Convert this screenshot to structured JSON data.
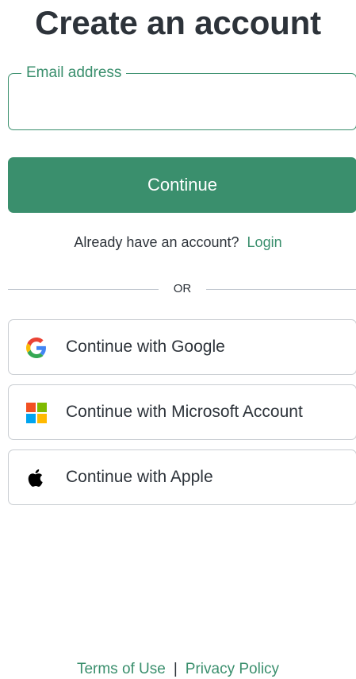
{
  "header": {
    "title": "Create an account"
  },
  "form": {
    "email_label": "Email address",
    "email_value": "",
    "continue_label": "Continue"
  },
  "login_prompt": {
    "text": "Already have an account?",
    "link_label": "Login"
  },
  "divider": {
    "label": "OR"
  },
  "social": [
    {
      "label": "Continue with Google",
      "icon": "google-icon"
    },
    {
      "label": "Continue with Microsoft Account",
      "icon": "microsoft-icon"
    },
    {
      "label": "Continue with Apple",
      "icon": "apple-icon"
    }
  ],
  "footer": {
    "terms_label": "Terms of Use",
    "separator": "|",
    "privacy_label": "Privacy Policy"
  },
  "colors": {
    "accent": "#3a8f6d",
    "text": "#2d333a",
    "border": "#c9cdd2"
  }
}
